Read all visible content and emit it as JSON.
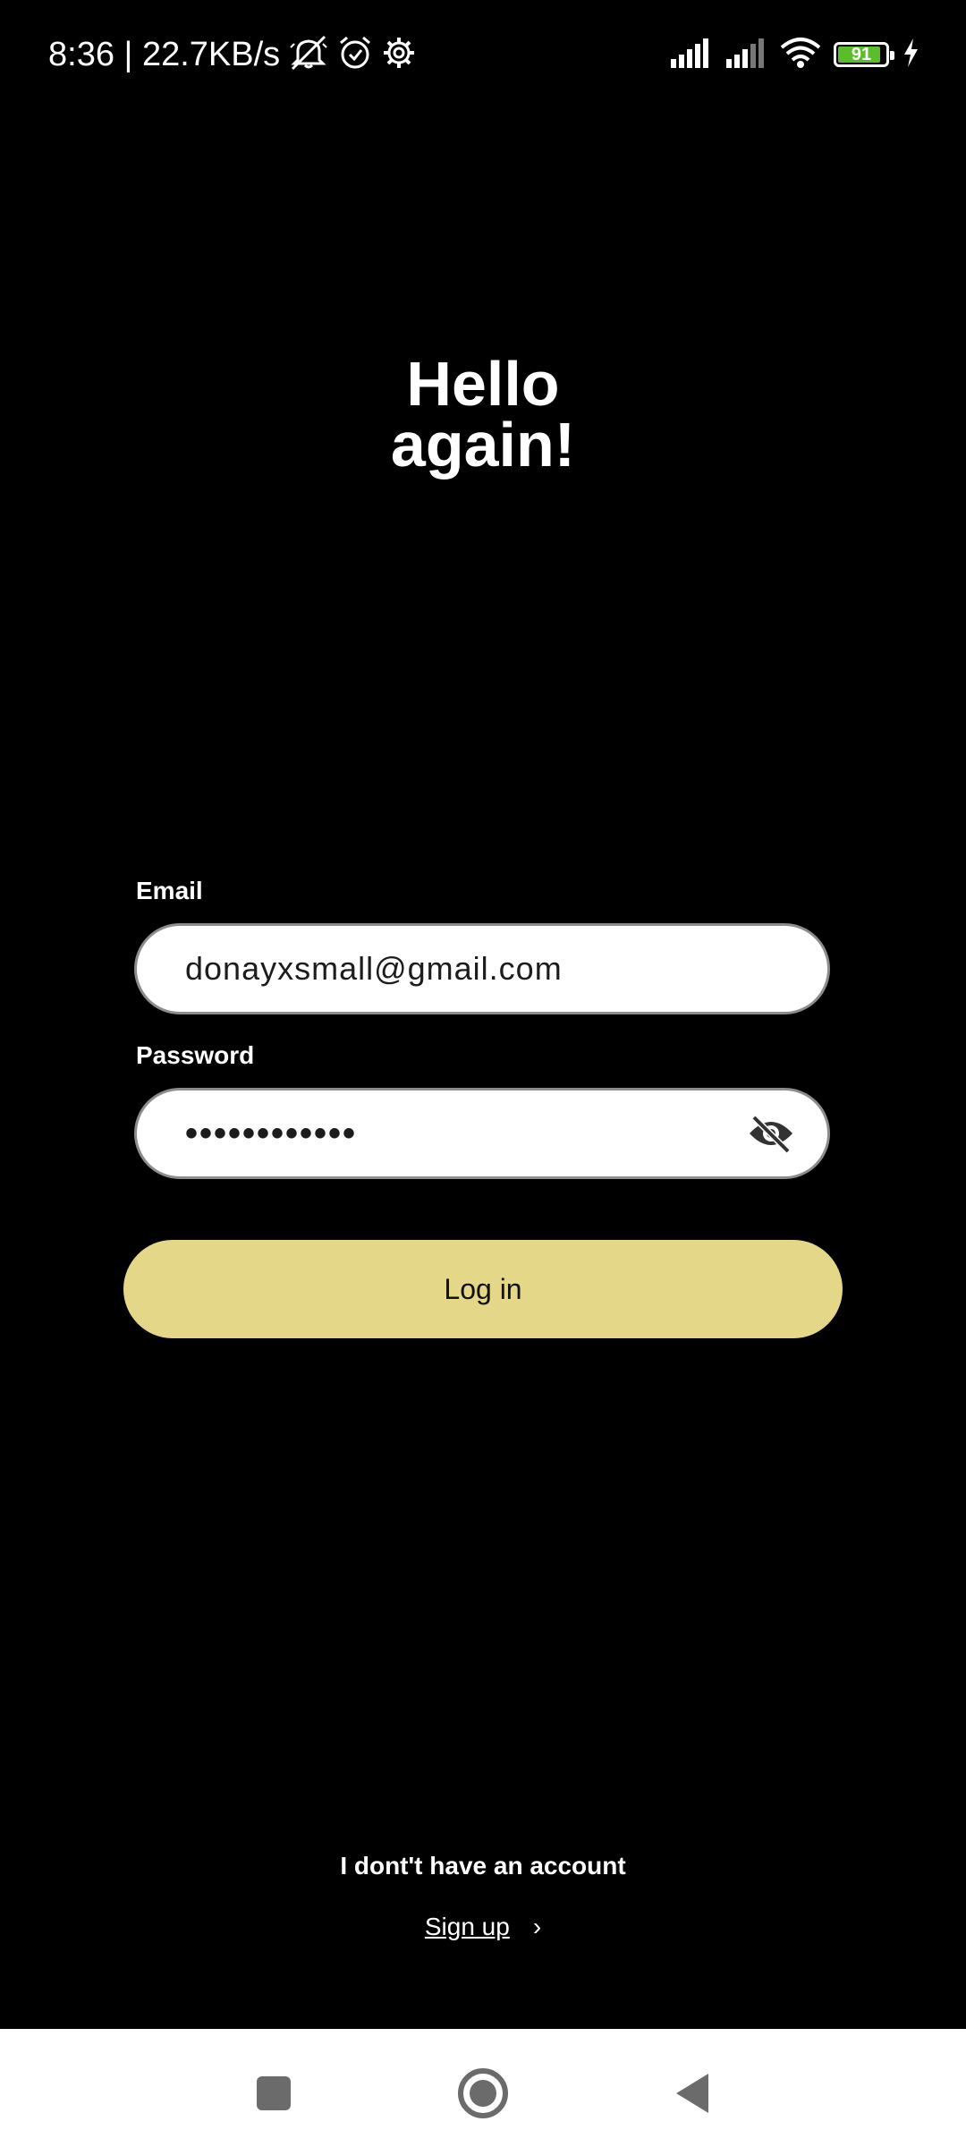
{
  "status_bar": {
    "time_info": "8:36 | 22.7KB/s",
    "battery_level": "91",
    "battery_fraction": 0.91,
    "icons": [
      "mute-icon",
      "alarm-icon",
      "settings-gear-icon",
      "signal-icon",
      "signal-icon-2",
      "wifi-icon",
      "battery-icon",
      "charging-icon"
    ]
  },
  "heading": {
    "line1": "Hello",
    "line2": "again!"
  },
  "form": {
    "email_label": "Email",
    "email_value": "donayxsmall@gmail.com",
    "password_label": "Password",
    "password_value": "••••••••••••",
    "login_label": "Log in"
  },
  "footer": {
    "no_account_text": "I dont't have an account",
    "signup_label": "Sign up",
    "chevron": "›"
  },
  "nav_bar": {
    "buttons": [
      "recents-button",
      "home-button",
      "back-button"
    ]
  },
  "colors": {
    "background": "#000000",
    "accent_button": "#e4d787",
    "battery_green": "#5bbd2c"
  }
}
